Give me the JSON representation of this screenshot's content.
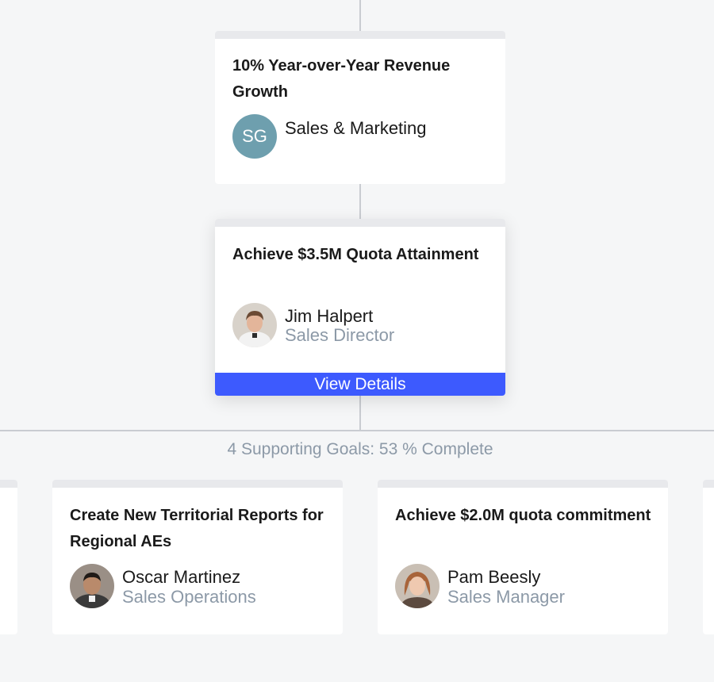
{
  "parent_goal": {
    "title": "10% Year-over-Year Revenue Growth",
    "owner_initials": "SG",
    "owner_name": "Sales & Marketing"
  },
  "current_goal": {
    "title": "Achieve $3.5M Quota Attainment",
    "owner_name": "Jim Halpert",
    "owner_role": "Sales Director",
    "button_label": "View Details"
  },
  "summary": "4 Supporting Goals: 53 % Complete",
  "supporting_goals": [
    {
      "title": "Create New Territorial Reports for Regional AEs",
      "owner_name": "Oscar Martinez",
      "owner_role": "Sales Operations"
    },
    {
      "title": "Achieve $2.0M quota commitment",
      "owner_name": "Pam Beesly",
      "owner_role": "Sales Manager"
    }
  ],
  "colors": {
    "accent": "#3d5afe",
    "initials_avatar": "#6e9fae",
    "muted_text": "#8c99a7",
    "connector": "#c9ccd1"
  }
}
